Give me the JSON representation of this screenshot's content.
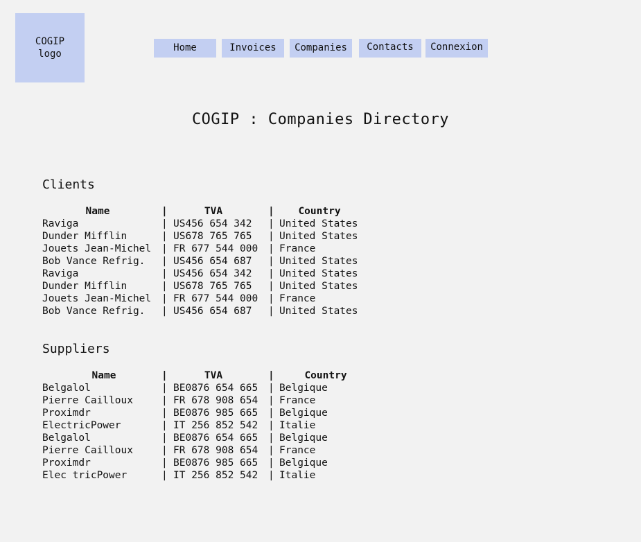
{
  "logo": {
    "label": "COGIP\nlogo"
  },
  "nav": {
    "items": [
      {
        "label": "Home"
      },
      {
        "label": "Invoices"
      },
      {
        "label": "Companies"
      },
      {
        "label": "Contacts"
      },
      {
        "label": "Connexion"
      }
    ]
  },
  "page": {
    "title": "COGIP : Companies Directory"
  },
  "clients": {
    "title": "Clients",
    "headers": {
      "name": "Name",
      "tva": "TVA",
      "country": "Country"
    },
    "separator": "|",
    "rows": [
      {
        "name": "Raviga",
        "tva": "US456 654 342",
        "country": "United States"
      },
      {
        "name": "Dunder Mifflin",
        "tva": "US678 765 765",
        "country": "United States"
      },
      {
        "name": "Jouets Jean-Michel",
        "tva": "FR 677 544 000",
        "country": "France"
      },
      {
        "name": "Bob Vance Refrig.",
        "tva": "US456 654 687",
        "country": "United States"
      },
      {
        "name": "Raviga",
        "tva": "US456 654 342",
        "country": "United States"
      },
      {
        "name": "Dunder Mifflin",
        "tva": "US678 765 765",
        "country": "United States"
      },
      {
        "name": "Jouets Jean-Michel",
        "tva": "FR 677 544 000",
        "country": "France"
      },
      {
        "name": "Bob Vance Refrig.",
        "tva": "US456 654 687",
        "country": "United States"
      }
    ]
  },
  "suppliers": {
    "title": "Suppliers",
    "headers": {
      "name": "Name",
      "tva": "TVA",
      "country": "Country"
    },
    "separator": "|",
    "rows": [
      {
        "name": "Belgalol",
        "tva": "BE0876 654 665",
        "country": "Belgique"
      },
      {
        "name": "Pierre Cailloux",
        "tva": "FR 678 908 654",
        "country": "France"
      },
      {
        "name": "Proximdr",
        "tva": "BE0876 985 665",
        "country": "Belgique"
      },
      {
        "name": "ElectricPower",
        "tva": "IT 256 852 542",
        "country": "Italie"
      },
      {
        "name": "Belgalol",
        "tva": "BE0876 654 665",
        "country": "Belgique"
      },
      {
        "name": "Pierre Cailloux",
        "tva": "FR 678 908 654",
        "country": "France"
      },
      {
        "name": "Proximdr",
        "tva": "BE0876 985 665",
        "country": "Belgique"
      },
      {
        "name": "Elec tricPower",
        "tva": "IT 256 852 542",
        "country": "Italie"
      }
    ]
  }
}
